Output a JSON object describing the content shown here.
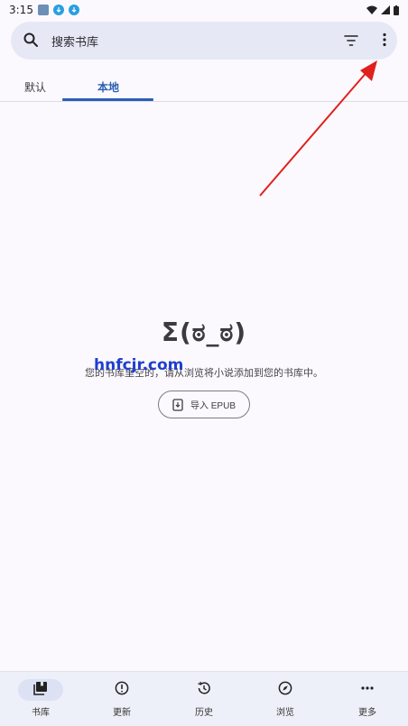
{
  "status_bar": {
    "time": "3:15"
  },
  "search": {
    "placeholder": "搜索书库"
  },
  "tabs": [
    {
      "label": "默认"
    },
    {
      "label": "本地"
    }
  ],
  "empty_state": {
    "face": "Σ(ಠ_ಠ)",
    "message": "您的书库里空的，请从浏览将小说添加到您的书库中。",
    "watermark": "hnfcjr.com",
    "import_button": "导入 EPUB"
  },
  "bottom_nav": [
    {
      "label": "书库",
      "icon": "library-icon"
    },
    {
      "label": "更新",
      "icon": "alert-circle-icon"
    },
    {
      "label": "历史",
      "icon": "history-icon"
    },
    {
      "label": "浏览",
      "icon": "compass-icon"
    },
    {
      "label": "更多",
      "icon": "more-horizontal-icon"
    }
  ],
  "colors": {
    "accent": "#2b5fb3",
    "arrow": "#e0201c"
  }
}
